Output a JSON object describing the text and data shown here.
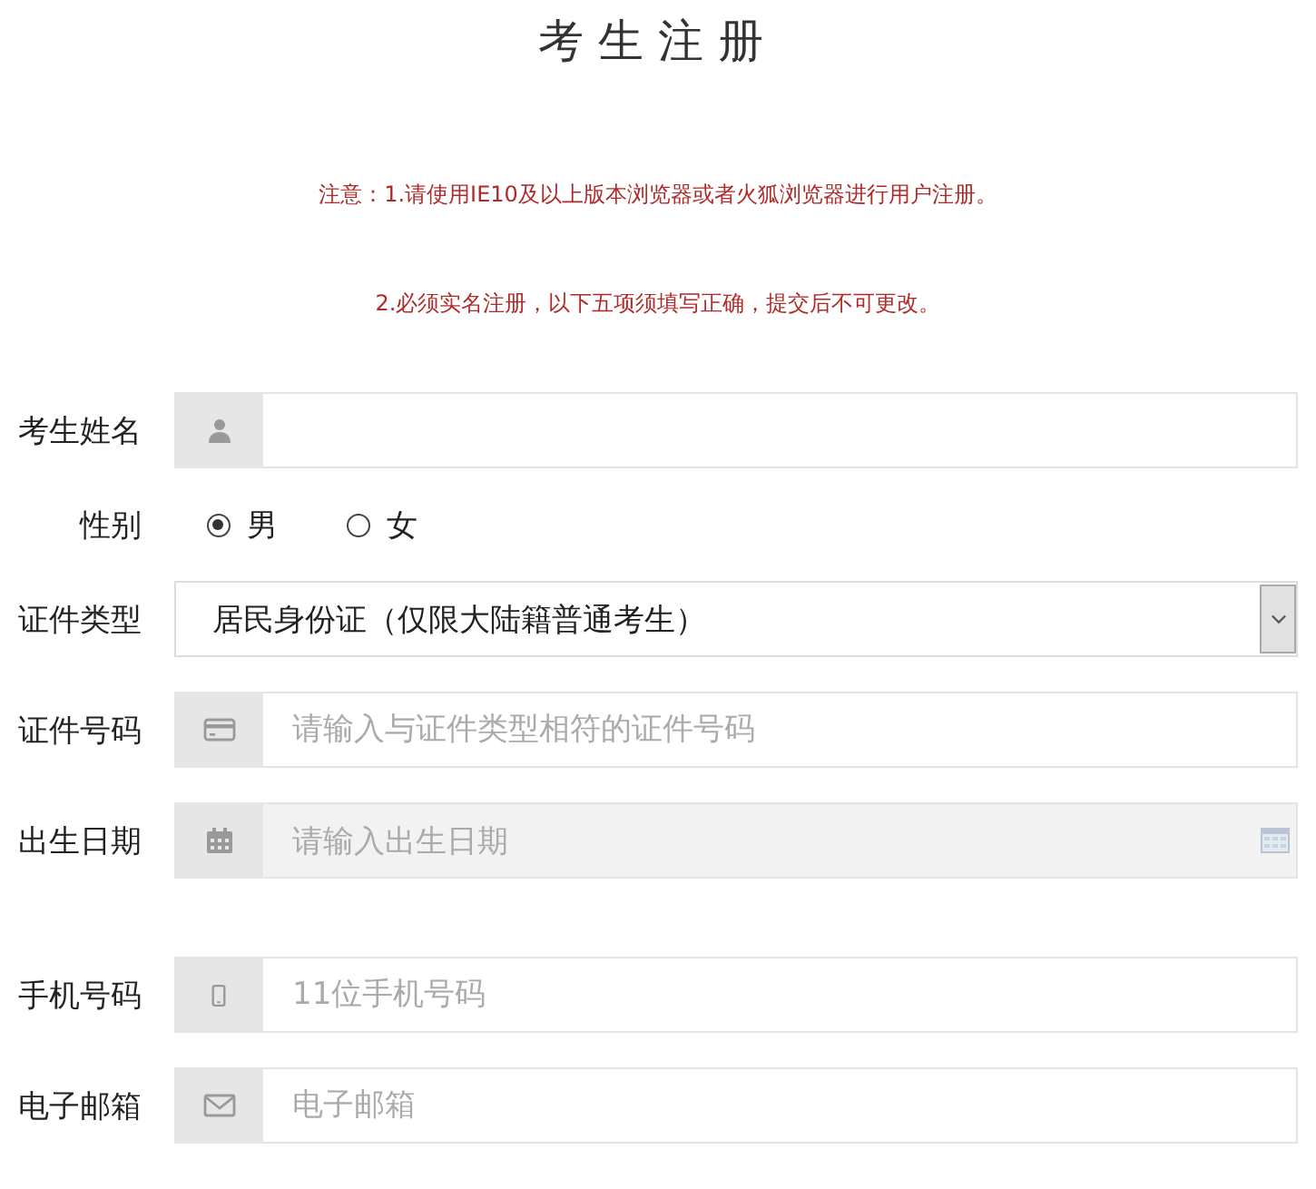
{
  "title": "考生注册",
  "notices": [
    "注意：1.请使用IE10及以上版本浏览器或者火狐浏览器进行用户注册。",
    "2.必须实名注册，以下五项须填写正确，提交后不可更改。"
  ],
  "fields": [
    {
      "kind": "name",
      "label": "考生姓名"
    },
    {
      "kind": "gender",
      "label": "性别",
      "options": [
        {
          "label": "男",
          "selected": true
        },
        {
          "label": "女",
          "selected": false
        }
      ]
    },
    {
      "kind": "select",
      "label": "证件类型",
      "value": "居民身份证（仅限大陆籍普通考生）"
    },
    {
      "kind": "idcard",
      "label": "证件号码",
      "placeholder": "请输入与证件类型相符的证件号码"
    },
    {
      "kind": "date",
      "label": "出生日期",
      "placeholder": "请输入出生日期"
    },
    {
      "kind": "phone",
      "label": "手机号码",
      "placeholder": "11位手机号码"
    },
    {
      "kind": "email",
      "label": "电子邮箱",
      "placeholder": "电子邮箱"
    }
  ]
}
